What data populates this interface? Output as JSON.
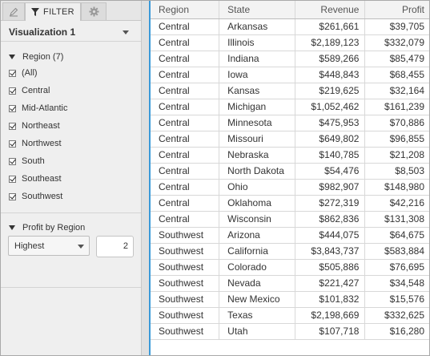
{
  "tabs": {
    "filter_label": "FILTER"
  },
  "visualization": {
    "title": "Visualization 1"
  },
  "region_filter": {
    "label": "Region (7)",
    "items": [
      "(All)",
      "Central",
      "Mid-Atlantic",
      "Northeast",
      "Northwest",
      "South",
      "Southeast",
      "Southwest"
    ]
  },
  "profit_filter": {
    "label": "Profit by Region",
    "mode": "Highest",
    "count": "2"
  },
  "table": {
    "headers": [
      "Region",
      "State",
      "Revenue",
      "Profit"
    ],
    "rows": [
      [
        "Central",
        "Arkansas",
        "$261,661",
        "$39,705"
      ],
      [
        "Central",
        "Illinois",
        "$2,189,123",
        "$332,079"
      ],
      [
        "Central",
        "Indiana",
        "$589,266",
        "$85,479"
      ],
      [
        "Central",
        "Iowa",
        "$448,843",
        "$68,455"
      ],
      [
        "Central",
        "Kansas",
        "$219,625",
        "$32,164"
      ],
      [
        "Central",
        "Michigan",
        "$1,052,462",
        "$161,239"
      ],
      [
        "Central",
        "Minnesota",
        "$475,953",
        "$70,886"
      ],
      [
        "Central",
        "Missouri",
        "$649,802",
        "$96,855"
      ],
      [
        "Central",
        "Nebraska",
        "$140,785",
        "$21,208"
      ],
      [
        "Central",
        "North Dakota",
        "$54,476",
        "$8,503"
      ],
      [
        "Central",
        "Ohio",
        "$982,907",
        "$148,980"
      ],
      [
        "Central",
        "Oklahoma",
        "$272,319",
        "$42,216"
      ],
      [
        "Central",
        "Wisconsin",
        "$862,836",
        "$131,308"
      ],
      [
        "Southwest",
        "Arizona",
        "$444,075",
        "$64,675"
      ],
      [
        "Southwest",
        "California",
        "$3,843,737",
        "$583,884"
      ],
      [
        "Southwest",
        "Colorado",
        "$505,886",
        "$76,695"
      ],
      [
        "Southwest",
        "Nevada",
        "$221,427",
        "$34,548"
      ],
      [
        "Southwest",
        "New Mexico",
        "$101,832",
        "$15,576"
      ],
      [
        "Southwest",
        "Texas",
        "$2,198,669",
        "$332,625"
      ],
      [
        "Southwest",
        "Utah",
        "$107,718",
        "$16,280"
      ]
    ]
  }
}
